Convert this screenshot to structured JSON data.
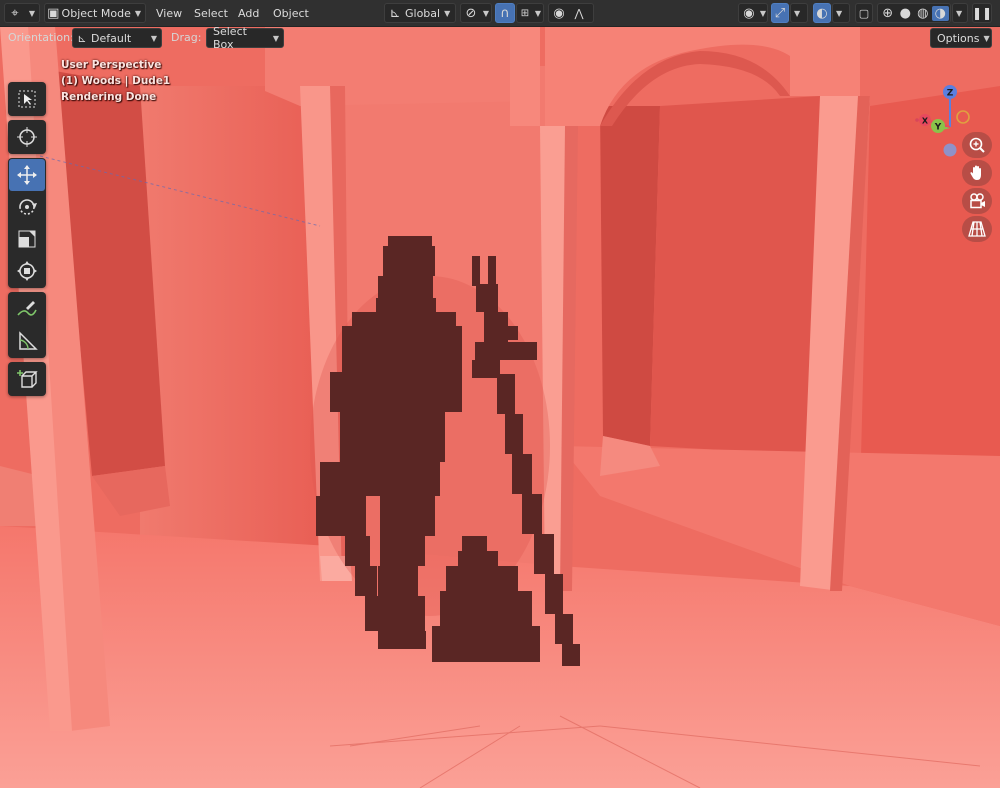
{
  "header": {
    "mode_label": "Object Mode",
    "menus": [
      "View",
      "Select",
      "Add",
      "Object"
    ],
    "transform_orientation": "Global"
  },
  "tool_settings": {
    "orientation_label": "Orientation:",
    "orientation_value": "Default",
    "drag_label": "Drag:",
    "drag_value": "Select Box",
    "options_label": "Options"
  },
  "viewport": {
    "overlay_lines": [
      "User Perspective",
      "(1) Woods | Dude1",
      "Rendering Done"
    ]
  },
  "gizmo": {
    "z_label": "Z",
    "y_label": "Y",
    "x_label": "X"
  },
  "colors": {
    "active_blue": "#4772b3",
    "scene_red": "#f06a60",
    "silhouette": "#5a2624"
  },
  "icons": {
    "editor_type": "editor-type-icon",
    "mode": "object-mode-icon",
    "orientation": "global-orientation-icon",
    "pivot": "pivot-icon",
    "snap": "snap-magnet-icon",
    "snap_target": "snap-increment-icon",
    "proportional": "proportional-editing-icon",
    "visibility": "visibility-eye-icon",
    "gizmo": "gizmo-icon",
    "overlay": "overlay-icon",
    "xray": "xray-icon",
    "shading": [
      "wireframe-shading-icon",
      "solid-shading-icon",
      "material-shading-icon",
      "rendered-shading-icon"
    ]
  }
}
